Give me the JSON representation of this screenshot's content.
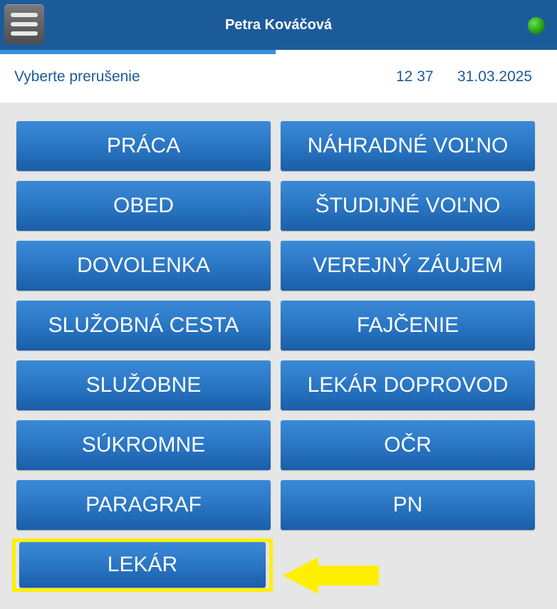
{
  "header": {
    "menu_icon": "hamburger-menu-icon",
    "user_name": "Petra Kováčová",
    "status_icon": "green-status-dot",
    "status_color": "#22aa18",
    "accent": "#1c5b9a"
  },
  "progress": {
    "fraction": 0.495
  },
  "subheader": {
    "prompt": "Vyberte prerušenie",
    "time": "12 37",
    "date": "31.03.2025"
  },
  "buttons_left": [
    "PRÁCA",
    "OBED",
    "DOVOLENKA",
    "SLUŽOBNÁ CESTA",
    "SLUŽOBNE",
    "SÚKROMNE",
    "PARAGRAF",
    "LEKÁR"
  ],
  "buttons_right": [
    "NÁHRADNÉ VOĽNO",
    "ŠTUDIJNÉ VOĽNO",
    "VEREJNÝ ZÁUJEM",
    "FAJČENIE",
    "LEKÁR DOPROVOD",
    "OČR",
    "PN"
  ],
  "annotation": {
    "highlight_color": "#ffef00",
    "arrow_icon": "yellow-left-arrow-icon"
  }
}
